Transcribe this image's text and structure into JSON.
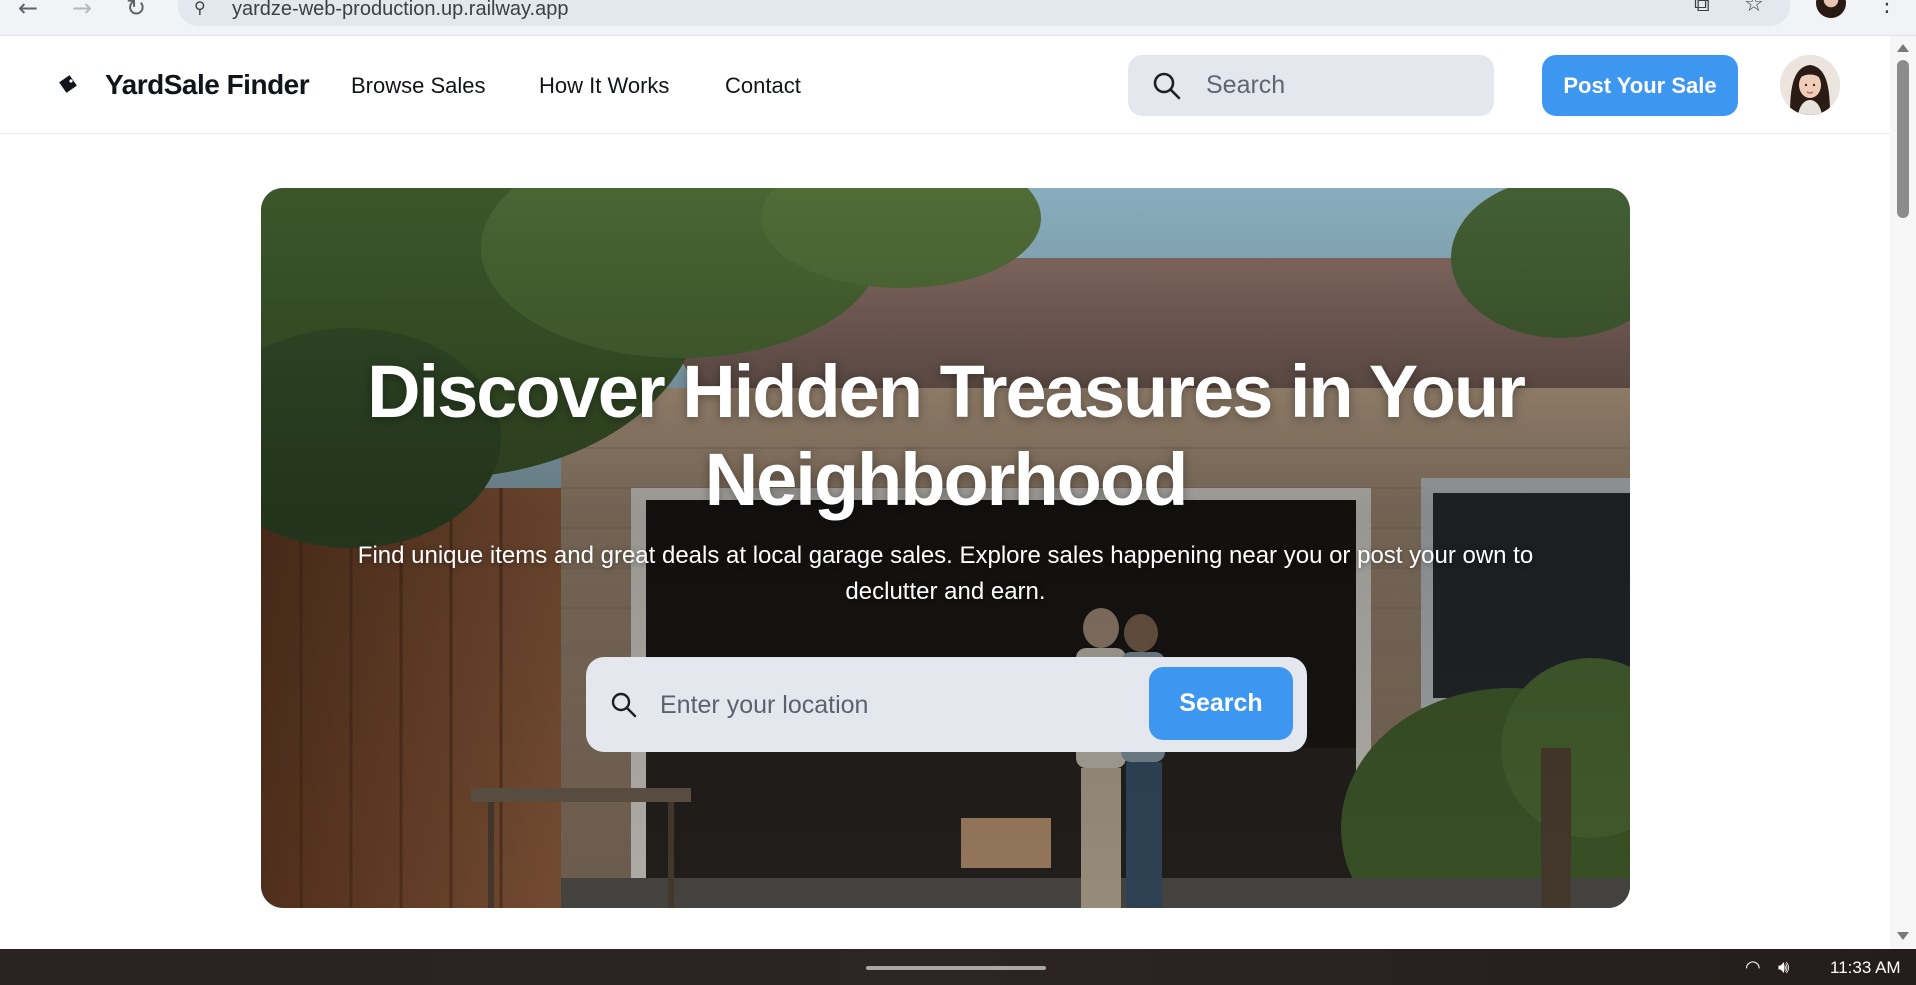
{
  "browser": {
    "back_glyph": "←",
    "forward_glyph": "→",
    "reload_glyph": "↻",
    "url": "yardze-web-production.up.railway.app",
    "site_icon": "tune-icon",
    "extension_icon": "extensions-icon",
    "bookmark_icon": "star-icon",
    "menu_icon": "more-vertical-icon"
  },
  "header": {
    "logo_text": "YardSale Finder",
    "nav": [
      "Browse Sales",
      "How It Works",
      "Contact"
    ],
    "search_placeholder": "Search",
    "post_button": "Post Your Sale"
  },
  "hero": {
    "title": "Discover Hidden Treasures in Your Neighborhood",
    "subtitle": "Find unique items and great deals at local garage sales. Explore sales happening near you or post your own to declutter and earn.",
    "search_placeholder": "Enter your location",
    "search_button": "Search"
  },
  "taskbar": {
    "wifi_icon": "wifi-icon",
    "volume_icon": "volume-icon",
    "time": "11:33 AM"
  },
  "colors": {
    "accent": "#3d97f0",
    "text": "#111418",
    "input_bg": "#e4e8ee"
  }
}
